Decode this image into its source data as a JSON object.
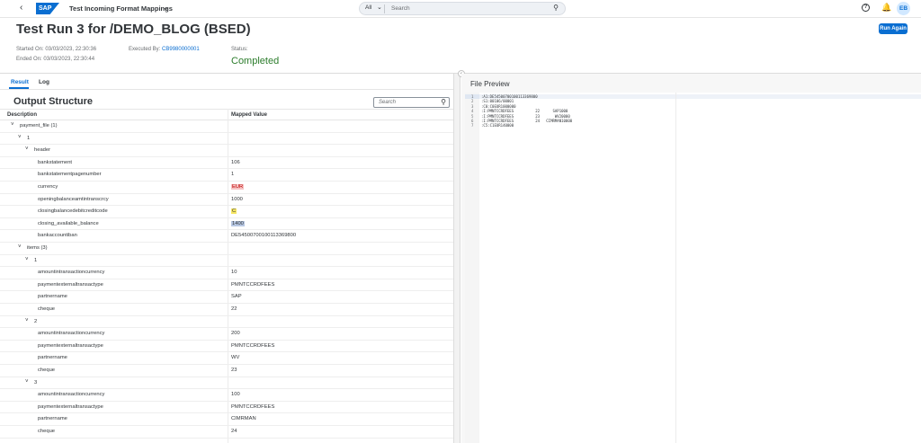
{
  "shell": {
    "back_icon": "back-arrow-icon",
    "logo_text": "SAP",
    "app_title": "Test Incoming Format Mappings",
    "search_scope": "All",
    "search_placeholder": "Search",
    "avatar_initials": "EB"
  },
  "header": {
    "title": "Test Run 3 for /DEMO_BLOG (BSED)",
    "run_again_label": "Run Again",
    "started_on": "Started On: 03/03/2023, 22:30:36",
    "ended_on": "Ended On: 03/03/2023, 22:30:44",
    "executed_by_label": "Executed By:",
    "executed_by_value": "CB9980000001",
    "status_label": "Status:",
    "status_value": "Completed"
  },
  "tabs": [
    {
      "label": "Result",
      "active": true
    },
    {
      "label": "Log",
      "active": false
    }
  ],
  "output": {
    "title": "Output Structure",
    "search_placeholder": "Search",
    "col_description": "Description",
    "col_mapped_value": "Mapped Value",
    "rows": [
      {
        "desc": "payment_file (1)",
        "value": "",
        "level": 0,
        "expander": true
      },
      {
        "desc": "1",
        "value": "",
        "level": 1,
        "expander": true
      },
      {
        "desc": "header",
        "value": "",
        "level": 2,
        "expander": true
      },
      {
        "desc": "bankstatement",
        "value": "106",
        "level": 3,
        "expander": false
      },
      {
        "desc": "bankstatementpagenumber",
        "value": "1",
        "level": 3,
        "expander": false
      },
      {
        "desc": "currency",
        "value": "EUR",
        "level": 3,
        "expander": false,
        "hl": "red"
      },
      {
        "desc": "openingbalanceamtintranscrcy",
        "value": "1000",
        "level": 3,
        "expander": false
      },
      {
        "desc": "closingbalancedebitcreditcode",
        "value": "C",
        "level": 3,
        "expander": false,
        "hl": "yellow"
      },
      {
        "desc": "closing_available_balance",
        "value": "1400",
        "level": 3,
        "expander": false,
        "hl": "blue"
      },
      {
        "desc": "bankaccountiban",
        "value": "DE54500700100113369800",
        "level": 3,
        "expander": false
      },
      {
        "desc": "items (3)",
        "value": "",
        "level": 1,
        "expander": true
      },
      {
        "desc": "1",
        "value": "",
        "level": 2,
        "expander": true
      },
      {
        "desc": "amountintransactioncurrency",
        "value": "10",
        "level": 3,
        "expander": false
      },
      {
        "desc": "paymentexternaltransactype",
        "value": "PMNTCCRDFEES",
        "level": 3,
        "expander": false
      },
      {
        "desc": "partnername",
        "value": "SAP",
        "level": 3,
        "expander": false
      },
      {
        "desc": "cheque",
        "value": "22",
        "level": 3,
        "expander": false
      },
      {
        "desc": "2",
        "value": "",
        "level": 2,
        "expander": true
      },
      {
        "desc": "amountintransactioncurrency",
        "value": "200",
        "level": 3,
        "expander": false
      },
      {
        "desc": "paymentexternaltransactype",
        "value": "PMNTCCRDFEES",
        "level": 3,
        "expander": false
      },
      {
        "desc": "partnername",
        "value": "WV",
        "level": 3,
        "expander": false
      },
      {
        "desc": "cheque",
        "value": "23",
        "level": 3,
        "expander": false
      },
      {
        "desc": "3",
        "value": "",
        "level": 2,
        "expander": true
      },
      {
        "desc": "amountintransactioncurrency",
        "value": "100",
        "level": 3,
        "expander": false
      },
      {
        "desc": "paymentexternaltransactype",
        "value": "PMNTCCRDFEES",
        "level": 3,
        "expander": false
      },
      {
        "desc": "partnername",
        "value": "CIMRMAN",
        "level": 3,
        "expander": false
      },
      {
        "desc": "cheque",
        "value": "24",
        "level": 3,
        "expander": false
      }
    ]
  },
  "file_preview": {
    "title": "File Preview",
    "lines": [
      {
        "n": "1",
        "text": ":A1:DE54500700100113369800"
      },
      {
        "n": "2",
        "text": ":S1:00106/00001"
      },
      {
        "n": "3",
        "text": ":C0:C0EUR1000000"
      },
      {
        "n": "4",
        "text": ":I:PMNTCCRDFEES          22      SAP1000"
      },
      {
        "n": "5",
        "text": ":I:PMNTCCRDFEES          23       WV20000"
      },
      {
        "n": "6",
        "text": ":I:PMNTCCRDFEES          24   CIMRMAN10000"
      },
      {
        "n": "7",
        "text": ":C5:C1EUR140000"
      }
    ]
  }
}
